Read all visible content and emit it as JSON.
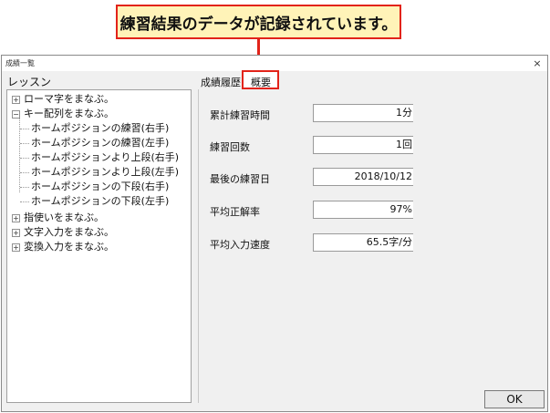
{
  "callout": {
    "text": "練習結果のデータが記録されています。"
  },
  "window": {
    "title": "成績一覧",
    "close": "×"
  },
  "lessons": {
    "heading": "レッスン",
    "items": [
      {
        "label": "ローマ字をまなぶ。",
        "expander": "+"
      },
      {
        "label": "キー配列をまなぶ。",
        "expander": "−"
      },
      {
        "label": "ホームポジションの練習(右手)"
      },
      {
        "label": "ホームポジションの練習(左手)"
      },
      {
        "label": "ホームポジションより上段(右手)"
      },
      {
        "label": "ホームポジションより上段(左手)"
      },
      {
        "label": "ホームポジションの下段(右手)"
      },
      {
        "label": "ホームポジションの下段(左手)"
      },
      {
        "label": "指使いをまなぶ。",
        "expander": "+"
      },
      {
        "label": "文字入力をまなぶ。",
        "expander": "+"
      },
      {
        "label": "変換入力をまなぶ。",
        "expander": "+"
      }
    ]
  },
  "tabs": {
    "history": "成績履歴",
    "summary": "概要"
  },
  "stats": [
    {
      "label": "累計練習時間",
      "value": "1分"
    },
    {
      "label": "練習回数",
      "value": "1回"
    },
    {
      "label": "最後の練習日",
      "value": "2018/10/12"
    },
    {
      "label": "平均正解率",
      "value": "97%"
    },
    {
      "label": "平均入力速度",
      "value": "65.5字/分"
    }
  ],
  "ok_label": "OK",
  "colors": {
    "accent": "#e2231a",
    "callout_bg": "#fff3b8"
  }
}
